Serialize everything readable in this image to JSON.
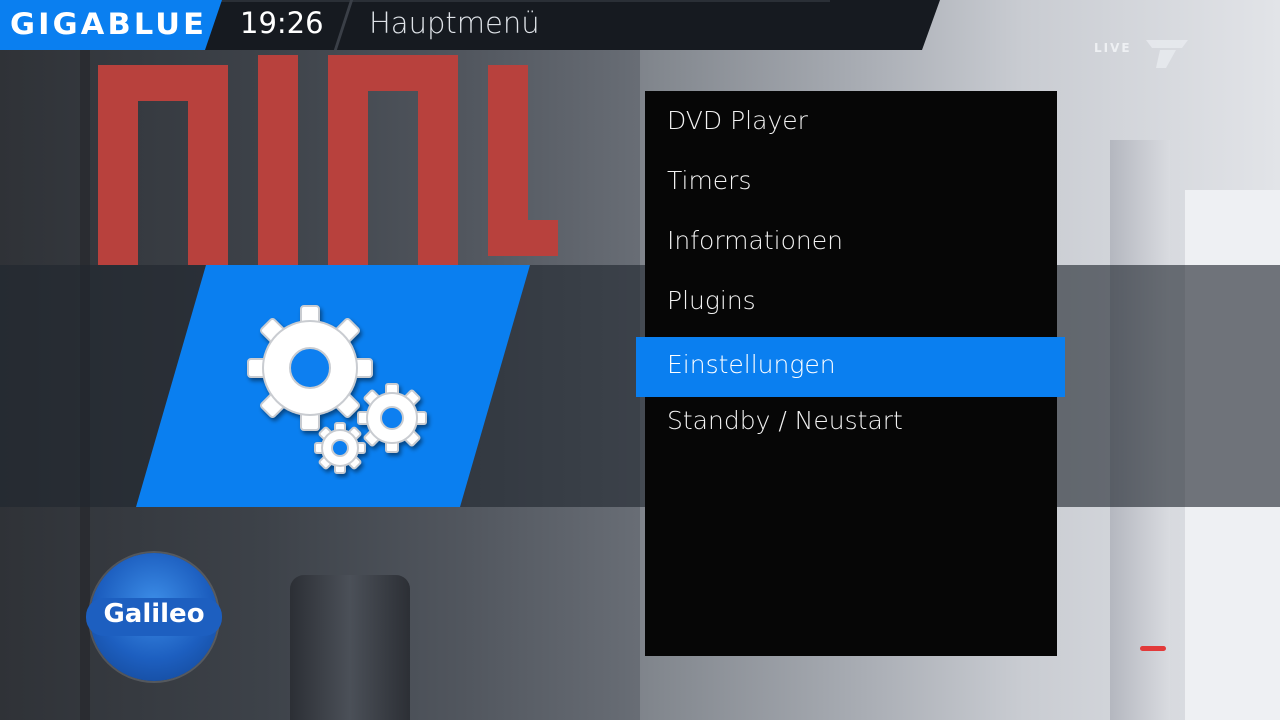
{
  "header": {
    "brand": "GIGABLUE",
    "time": "19:26",
    "title": "Hauptmenü"
  },
  "broadcast": {
    "live_badge": "LIVE",
    "channel_logo_text": "Galileo"
  },
  "selected_category": {
    "icon": "gears-icon"
  },
  "menu": {
    "items": [
      {
        "label": "DVD Player",
        "selected": false
      },
      {
        "label": "Timers",
        "selected": false
      },
      {
        "label": "Informationen",
        "selected": false
      },
      {
        "label": "Plugins",
        "selected": false
      },
      {
        "label": "Einstellungen",
        "selected": true
      },
      {
        "label": "Standby / Neustart",
        "selected": false
      }
    ]
  },
  "colors": {
    "accent": "#0a7ff0",
    "menu_background": "#060606",
    "topbar": "#161a20"
  }
}
